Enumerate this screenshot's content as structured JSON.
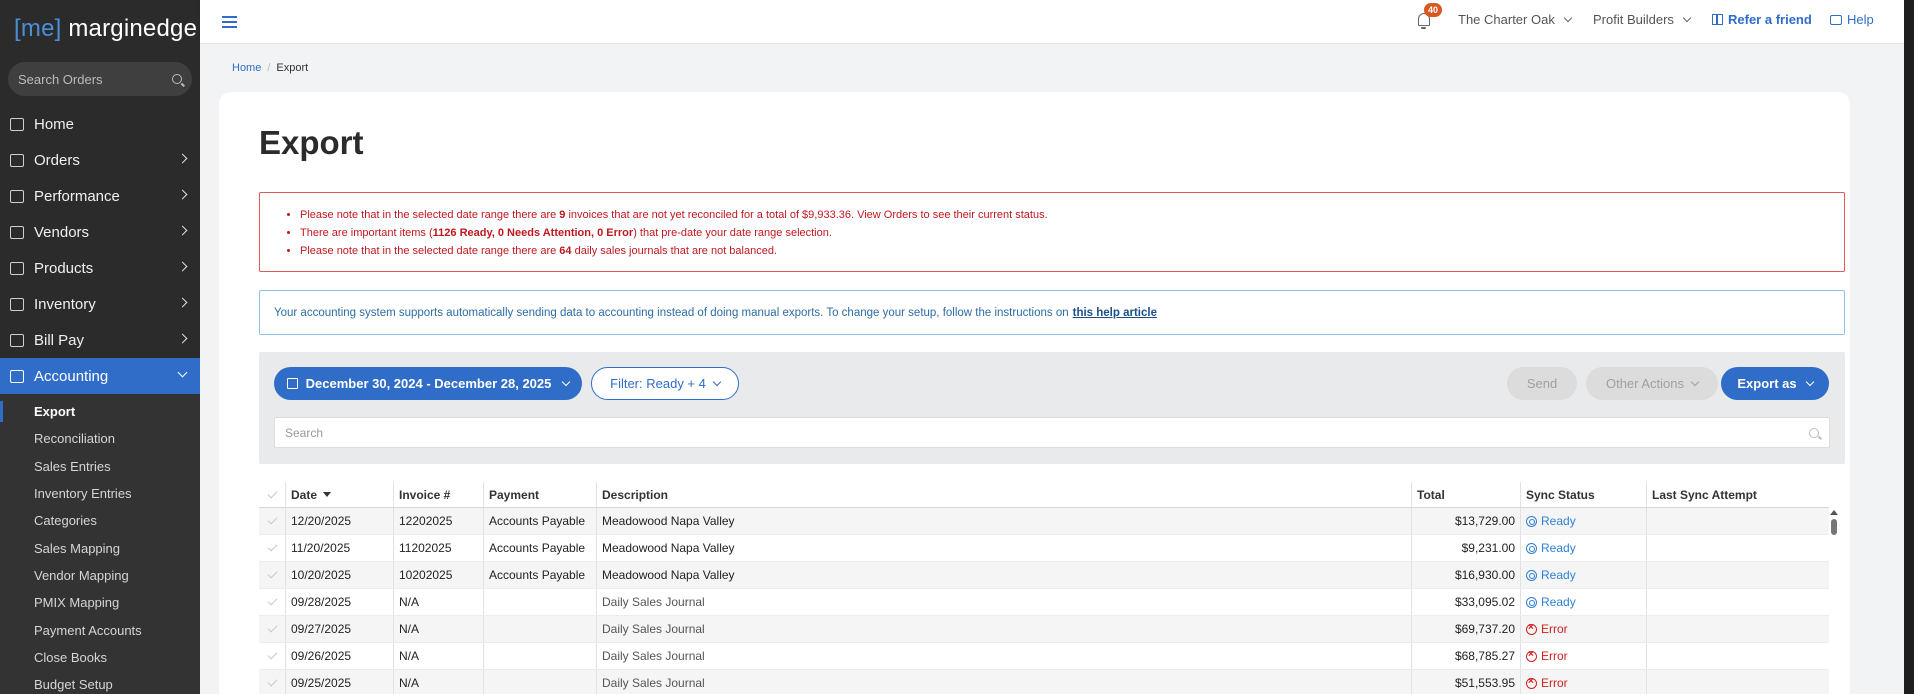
{
  "brand": {
    "bracket_open": "[",
    "initials": "me",
    "bracket_close": "]",
    "name": " marginedge"
  },
  "sidebar": {
    "search_placeholder": "Search Orders",
    "items": [
      {
        "label": "Home"
      },
      {
        "label": "Orders"
      },
      {
        "label": "Performance"
      },
      {
        "label": "Vendors"
      },
      {
        "label": "Products"
      },
      {
        "label": "Inventory"
      },
      {
        "label": "Bill Pay"
      },
      {
        "label": "Accounting"
      }
    ],
    "accounting_sub": [
      {
        "label": "Export"
      },
      {
        "label": "Reconciliation"
      },
      {
        "label": "Sales Entries"
      },
      {
        "label": "Inventory Entries"
      },
      {
        "label": "Categories"
      },
      {
        "label": "Sales Mapping"
      },
      {
        "label": "Vendor Mapping"
      },
      {
        "label": "PMIX Mapping"
      },
      {
        "label": "Payment Accounts"
      },
      {
        "label": "Close Books"
      },
      {
        "label": "Budget Setup"
      }
    ]
  },
  "topbar": {
    "notification_count": "40",
    "restaurant": "The Charter Oak",
    "group": "Profit Builders",
    "refer": "Refer a friend",
    "help": "Help"
  },
  "breadcrumb": {
    "home": "Home",
    "current": "Export"
  },
  "page": {
    "title": "Export"
  },
  "alerts": {
    "line1_pre": "Please note that in the selected date range there are ",
    "line1_count": "9",
    "line1_post": " invoices that are not yet reconciled for a total of $9,933.36. View Orders to see their current status.",
    "line2_pre": "There are important items (",
    "line2_bold": "1126 Ready, 0 Needs Attention, 0 Error",
    "line2_post": ") that pre-date your date range selection.",
    "line3_pre": "Please note that in the selected date range there are ",
    "line3_count": "64",
    "line3_post": " daily sales journals that are not balanced."
  },
  "info": {
    "text": "Your accounting system supports automatically sending data to accounting instead of doing manual exports. To change your setup, follow the instructions on",
    "link": "this help article"
  },
  "toolbar": {
    "date_range": "December 30, 2024 - December 28, 2025",
    "filter": "Filter: Ready + 4",
    "send": "Send",
    "other_actions": "Other Actions",
    "export_as": "Export as",
    "search_placeholder": "Search"
  },
  "table": {
    "headers": {
      "date": "Date",
      "invoice": "Invoice #",
      "payment": "Payment",
      "description": "Description",
      "total": "Total",
      "sync": "Sync Status",
      "last": "Last Sync Attempt"
    },
    "rows": [
      {
        "date": "12/20/2025",
        "invoice": "12202025",
        "payment": "Accounts Payable",
        "description": "Meadowood Napa Valley",
        "total": "$13,729.00",
        "status": "Ready",
        "last": ""
      },
      {
        "date": "11/20/2025",
        "invoice": "11202025",
        "payment": "Accounts Payable",
        "description": "Meadowood Napa Valley",
        "total": "$9,231.00",
        "status": "Ready",
        "last": ""
      },
      {
        "date": "10/20/2025",
        "invoice": "10202025",
        "payment": "Accounts Payable",
        "description": "Meadowood Napa Valley",
        "total": "$16,930.00",
        "status": "Ready",
        "last": ""
      },
      {
        "date": "09/28/2025",
        "invoice": "N/A",
        "payment": "",
        "description": "Daily Sales Journal",
        "total": "$33,095.02",
        "status": "Ready",
        "last": ""
      },
      {
        "date": "09/27/2025",
        "invoice": "N/A",
        "payment": "",
        "description": "Daily Sales Journal",
        "total": "$69,737.20",
        "status": "Error",
        "last": ""
      },
      {
        "date": "09/26/2025",
        "invoice": "N/A",
        "payment": "",
        "description": "Daily Sales Journal",
        "total": "$68,785.27",
        "status": "Error",
        "last": ""
      },
      {
        "date": "09/25/2025",
        "invoice": "N/A",
        "payment": "",
        "description": "Daily Sales Journal",
        "total": "$51,553.95",
        "status": "Error",
        "last": ""
      }
    ]
  },
  "colors": {
    "accent": "#2f6dc9",
    "error": "#d0201f",
    "ready": "#2f7fd6",
    "sidebar": "#2b2b2b"
  }
}
